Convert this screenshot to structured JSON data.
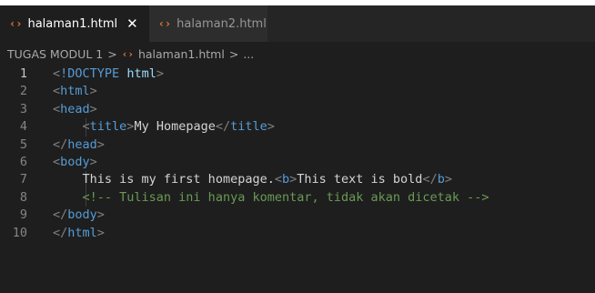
{
  "tabs": [
    {
      "icon": "‹›",
      "label": "halaman1.html",
      "active": true,
      "close": "✕"
    },
    {
      "icon": "‹›",
      "label": "halaman2.html",
      "active": false
    }
  ],
  "breadcrumb": {
    "folder": "TUGAS MODUL 1",
    "sep": ">",
    "icon": "‹›",
    "file": "halaman1.html",
    "more": "..."
  },
  "lines": [
    {
      "n": "1",
      "indent": "",
      "tokens": [
        [
          "t-punc",
          "<"
        ],
        [
          "t-doctype",
          "!DOCTYPE"
        ],
        [
          "t-text",
          " "
        ],
        [
          "t-kw",
          "html"
        ],
        [
          "t-punc",
          ">"
        ]
      ]
    },
    {
      "n": "2",
      "indent": "",
      "tokens": [
        [
          "t-punc",
          "<"
        ],
        [
          "t-tag",
          "html"
        ],
        [
          "t-punc",
          ">"
        ]
      ]
    },
    {
      "n": "3",
      "indent": "",
      "tokens": [
        [
          "t-punc",
          "<"
        ],
        [
          "t-tag",
          "head"
        ],
        [
          "t-punc",
          ">"
        ]
      ]
    },
    {
      "n": "4",
      "indent": "    ",
      "tokens": [
        [
          "t-punc",
          "<"
        ],
        [
          "t-tag",
          "title"
        ],
        [
          "t-punc",
          ">"
        ],
        [
          "t-text",
          "My Homepage"
        ],
        [
          "t-punc",
          "</"
        ],
        [
          "t-tag",
          "title"
        ],
        [
          "t-punc",
          ">"
        ]
      ]
    },
    {
      "n": "5",
      "indent": "",
      "tokens": [
        [
          "t-punc",
          "</"
        ],
        [
          "t-tag",
          "head"
        ],
        [
          "t-punc",
          ">"
        ]
      ]
    },
    {
      "n": "6",
      "indent": "",
      "tokens": [
        [
          "t-punc",
          "<"
        ],
        [
          "t-tag",
          "body"
        ],
        [
          "t-punc",
          ">"
        ]
      ]
    },
    {
      "n": "7",
      "indent": "    ",
      "tokens": [
        [
          "t-text",
          "This is my first homepage."
        ],
        [
          "t-punc",
          "<"
        ],
        [
          "t-tag",
          "b"
        ],
        [
          "t-punc",
          ">"
        ],
        [
          "t-text",
          "This text is bold"
        ],
        [
          "t-punc",
          "</"
        ],
        [
          "t-tag",
          "b"
        ],
        [
          "t-punc",
          ">"
        ]
      ]
    },
    {
      "n": "8",
      "indent": "    ",
      "tokens": [
        [
          "t-comment",
          "<!-- Tulisan ini hanya komentar, tidak akan dicetak -->"
        ]
      ]
    },
    {
      "n": "9",
      "indent": "",
      "tokens": [
        [
          "t-punc",
          "</"
        ],
        [
          "t-tag",
          "body"
        ],
        [
          "t-punc",
          ">"
        ]
      ]
    },
    {
      "n": "10",
      "indent": "",
      "tokens": [
        [
          "t-punc",
          "</"
        ],
        [
          "t-tag",
          "html"
        ],
        [
          "t-punc",
          ">"
        ]
      ]
    }
  ],
  "colors": {
    "editor_bg": "#1e1e1e",
    "tab_bar_bg": "#252526",
    "tag": "#569cd6",
    "punctuation": "#808080",
    "comment": "#6a9955",
    "text": "#d4d4d4",
    "html_icon": "#e37933"
  }
}
